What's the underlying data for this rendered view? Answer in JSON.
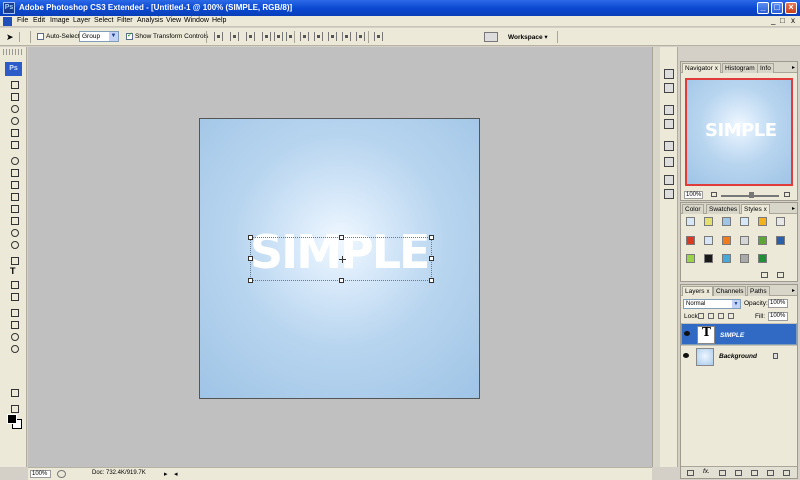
{
  "window": {
    "title": "Adobe Photoshop CS3 Extended - [Untitled-1 @ 100% (SIMPLE, RGB/8)]",
    "app_icon": "Ps",
    "controls": [
      "minimize",
      "maximize",
      "close"
    ]
  },
  "menu": {
    "items": [
      "File",
      "Edit",
      "Image",
      "Layer",
      "Select",
      "Filter",
      "Analysis",
      "View",
      "Window",
      "Help"
    ],
    "right_controls": [
      "_",
      "□",
      "x"
    ]
  },
  "options_bar": {
    "auto_select_label": "Auto-Select:",
    "auto_select_checked": false,
    "auto_select_value": "Group",
    "show_transform_label": "Show Transform Controls",
    "show_transform_checked": true,
    "workspace_label": "Workspace ▾"
  },
  "tools": {
    "logo": "Ps",
    "icons": [
      "move-icon",
      "marquee-icon",
      "lasso-icon",
      "quick-selection-icon",
      "crop-icon",
      "slice-icon",
      "healing-brush-icon",
      "brush-icon",
      "clone-stamp-icon",
      "history-brush-icon",
      "eraser-icon",
      "gradient-icon",
      "blur-icon",
      "dodge-icon",
      "pen-icon",
      "type-icon",
      "path-selection-icon",
      "shape-icon",
      "notes-icon",
      "eyedropper-icon",
      "hand-icon",
      "zoom-icon"
    ]
  },
  "document": {
    "text": "SIMPLE"
  },
  "status_bar": {
    "zoom": "100%",
    "doc_info": "Doc: 732.4K/919.7K",
    "nav_right": "▸",
    "nav_left": "◂"
  },
  "navigator_panel": {
    "tabs": [
      {
        "label": "Navigator",
        "close": "x"
      },
      {
        "label": "Histogram",
        "close": ""
      },
      {
        "label": "Info",
        "close": ""
      }
    ],
    "thumb_text": "SIMPLE",
    "zoom": "100%"
  },
  "styles_panel": {
    "tabs": [
      {
        "label": "Color",
        "close": ""
      },
      {
        "label": "Swatches",
        "close": ""
      },
      {
        "label": "Styles",
        "close": "x"
      }
    ],
    "swatches": [
      "#d8e6f5",
      "#e4e070",
      "#9fc4e6",
      "#d7e7f5",
      "#f1b21e",
      "#e7e7e7",
      "#d83a22",
      "#d6e6f6",
      "#f07a1c",
      "#d5d5d5",
      "#5fa534",
      "#2d5ea8",
      "#9cd24a",
      "#1a1a1a",
      "#49a8d8",
      "#aaaaaa",
      "#1f8f3a"
    ]
  },
  "layers_panel": {
    "tabs": [
      {
        "label": "Layers",
        "close": "x"
      },
      {
        "label": "Channels",
        "close": ""
      },
      {
        "label": "Paths",
        "close": ""
      }
    ],
    "blend_mode": "Normal",
    "opacity_label": "Opacity:",
    "opacity_value": "100%",
    "lock_label": "Lock:",
    "fill_label": "Fill:",
    "fill_value": "100%",
    "layers": [
      {
        "name": "SIMPLE",
        "type": "text",
        "selected": true
      },
      {
        "name": "Background",
        "type": "image",
        "selected": false,
        "locked": true
      }
    ],
    "bottom_fx_label": "fx."
  }
}
